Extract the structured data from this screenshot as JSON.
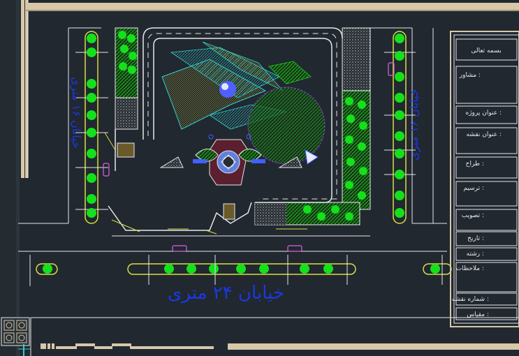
{
  "drawing": {
    "street_bottom": "خیابان ۲۴ متری",
    "street_left": "خیابان ۱۶ متری",
    "street_right": "خیابان ۱۶ متری"
  },
  "title_block": {
    "header": "بسمه تعالی",
    "fields": [
      "مشاور :",
      "عنوان پروژه :",
      "عنوان نقشه :",
      "طراح :",
      "ترسیم :",
      "تصویب :",
      "تاریخ :",
      "رشته :",
      "ملاحظات :",
      "شماره نقشه :",
      "مقیاس :"
    ]
  },
  "colors": {
    "background": "#212830",
    "cad_white": "#e8e8e8",
    "tree_green": "#15e01c",
    "street_text_blue": "#1c38e0",
    "frame_beige": "#d8c8a8",
    "vehicle_pink": "#e060e0",
    "tree_symbol_yellow": "#d8e040",
    "hatch_cyan": "#30d0d0"
  },
  "icons": [
    "grid-pattern-icon",
    "ucs-axis-icon",
    "north-arrow-icon"
  ]
}
